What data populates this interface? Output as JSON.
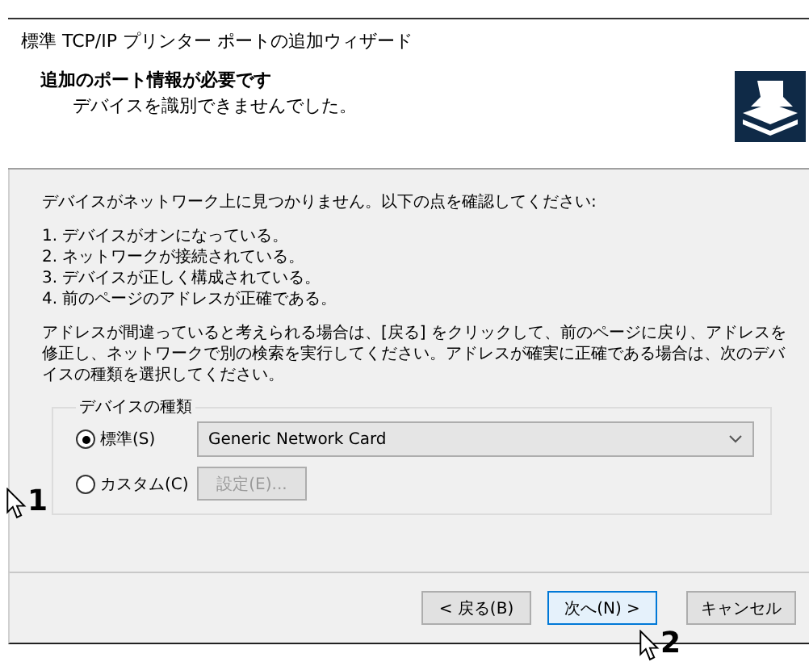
{
  "window": {
    "title": "標準 TCP/IP プリンター ポートの追加ウィザード"
  },
  "header": {
    "heading": "追加のポート情報が必要です",
    "subheading": "デバイスを識別できませんでした。"
  },
  "body": {
    "intro": "デバイスがネットワーク上に見つかりません。以下の点を確認してください:",
    "checklist": [
      "1. デバイスがオンになっている。",
      "2. ネットワークが接続されている。",
      "3. デバイスが正しく構成されている。",
      "4. 前のページのアドレスが正確である。"
    ],
    "advice": "アドレスが間違っていると考えられる場合は、[戻る] をクリックして、前のページに戻り、アドレスを修正し、ネットワークで別の検索を実行してください。アドレスが確実に正確である場合は、次のデバイスの種類を選択してください。"
  },
  "device_type": {
    "legend": "デバイスの種類",
    "options": [
      {
        "label": "標準(S)",
        "selected": true,
        "kind": "dropdown",
        "value": "Generic Network Card"
      },
      {
        "label": "カスタム(C)",
        "selected": false,
        "kind": "button",
        "button": "設定(E)...",
        "disabled": true
      }
    ]
  },
  "buttons": [
    {
      "label": "< 戻る(B)",
      "default": false
    },
    {
      "label": "次へ(N) >",
      "default": true
    },
    {
      "label": "キャンセル",
      "default": false
    }
  ],
  "annotations": [
    {
      "number": "1"
    },
    {
      "number": "2"
    }
  ]
}
